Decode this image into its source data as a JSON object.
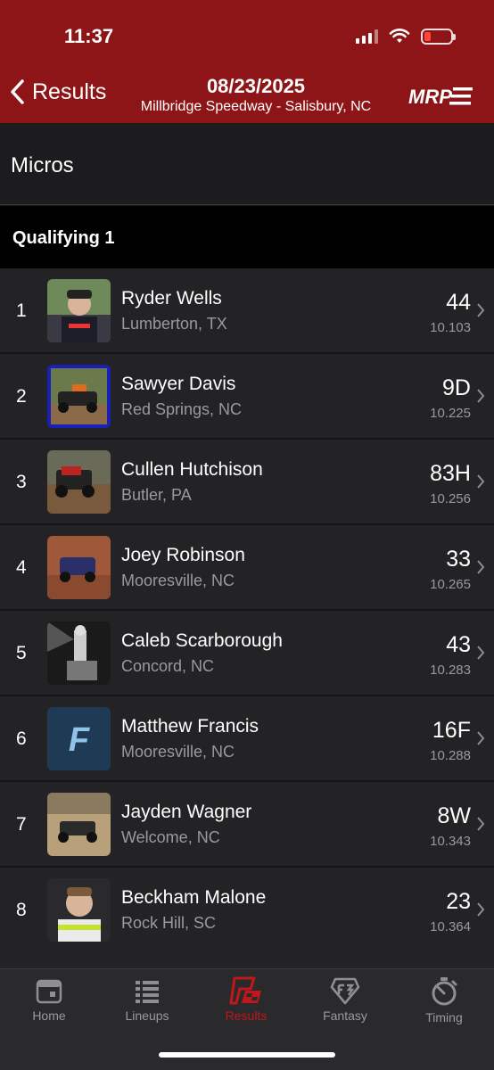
{
  "status_bar": {
    "time": "11:37"
  },
  "header": {
    "back_label": "Results",
    "date": "08/23/2025",
    "venue": "Millbridge Speedway - Salisbury, NC",
    "logo_text": "MRP",
    "bg_color": "#8e1517"
  },
  "class_name": "Micros",
  "session_name": "Qualifying 1",
  "results": [
    {
      "position": "1",
      "driver": "Ryder Wells",
      "hometown": "Lumberton, TX",
      "car": "44",
      "time": "10.103"
    },
    {
      "position": "2",
      "driver": "Sawyer Davis",
      "hometown": "Red Springs, NC",
      "car": "9D",
      "time": "10.225"
    },
    {
      "position": "3",
      "driver": "Cullen Hutchison",
      "hometown": "Butler, PA",
      "car": "83H",
      "time": "10.256"
    },
    {
      "position": "4",
      "driver": "Joey Robinson",
      "hometown": "Mooresville, NC",
      "car": "33",
      "time": "10.265"
    },
    {
      "position": "5",
      "driver": "Caleb Scarborough",
      "hometown": "Concord, NC",
      "car": "43",
      "time": "10.283"
    },
    {
      "position": "6",
      "driver": "Matthew Francis",
      "hometown": "Mooresville, NC",
      "car": "16F",
      "time": "10.288",
      "avatar_letter": "F"
    },
    {
      "position": "7",
      "driver": "Jayden Wagner",
      "hometown": "Welcome, NC",
      "car": "8W",
      "time": "10.343"
    },
    {
      "position": "8",
      "driver": "Beckham Malone",
      "hometown": "Rock Hill, SC",
      "car": "23",
      "time": "10.364"
    }
  ],
  "tabs": [
    {
      "label": "Home",
      "icon": "calendar-icon",
      "active": false
    },
    {
      "label": "Lineups",
      "icon": "list-icon",
      "active": false
    },
    {
      "label": "Results",
      "icon": "results-flag-icon",
      "active": true
    },
    {
      "label": "Fantasy",
      "icon": "fantasy-badge-icon",
      "active": false
    },
    {
      "label": "Timing",
      "icon": "stopwatch-icon",
      "active": false
    }
  ],
  "colors": {
    "accent": "#c0171c",
    "row_bg": "#232325",
    "secondary_text": "#9a9a9e"
  }
}
